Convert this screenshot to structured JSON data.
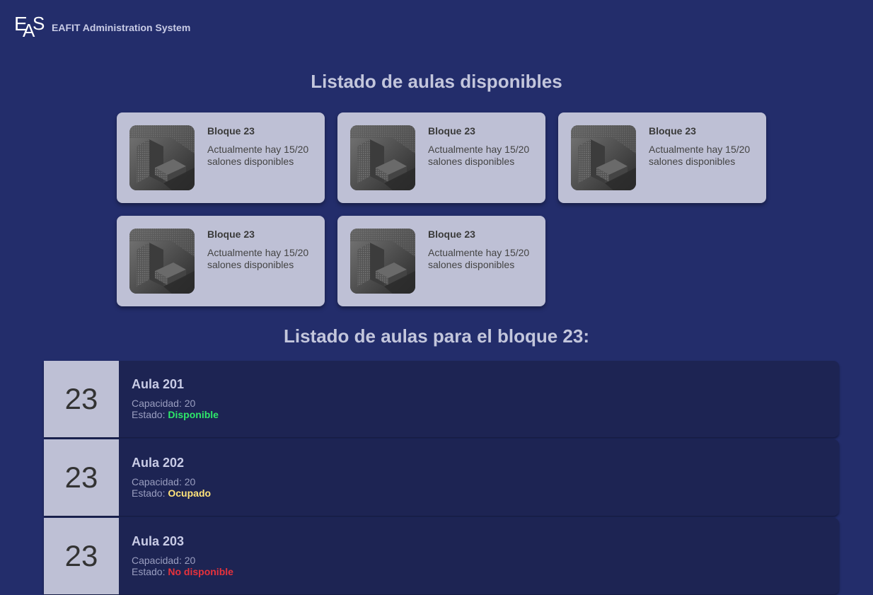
{
  "header": {
    "logo_text": "EAS",
    "logo_parts": [
      "E",
      "A",
      "S"
    ],
    "app_title": "EAFIT Administration System"
  },
  "sections": {
    "available_title": "Listado de aulas disponibles",
    "block_title": "Listado de aulas para el bloque 23:"
  },
  "blocks": [
    {
      "title": "Bloque 23",
      "text": "Actualmente hay 15/20 salones disponibles"
    },
    {
      "title": "Bloque 23",
      "text": "Actualmente hay 15/20 salones disponibles"
    },
    {
      "title": "Bloque 23",
      "text": "Actualmente hay 15/20 salones disponibles"
    },
    {
      "title": "Bloque 23",
      "text": "Actualmente hay 15/20 salones disponibles"
    },
    {
      "title": "Bloque 23",
      "text": "Actualmente hay 15/20 salones disponibles"
    }
  ],
  "rooms": [
    {
      "number": "23",
      "name": "Aula 201",
      "capacity": "Capacidad: 20",
      "state_label": "Estado:",
      "state": "Disponible",
      "state_color": "#2ee86a"
    },
    {
      "number": "23",
      "name": "Aula 202",
      "capacity": "Capacidad: 20",
      "state_label": "Estado:",
      "state": "Ocupado",
      "state_color": "#ffe37a"
    },
    {
      "number": "23",
      "name": "Aula 203",
      "capacity": "Capacidad: 20",
      "state_label": "Estado:",
      "state": "No disponible",
      "state_color": "#e8323c"
    }
  ]
}
